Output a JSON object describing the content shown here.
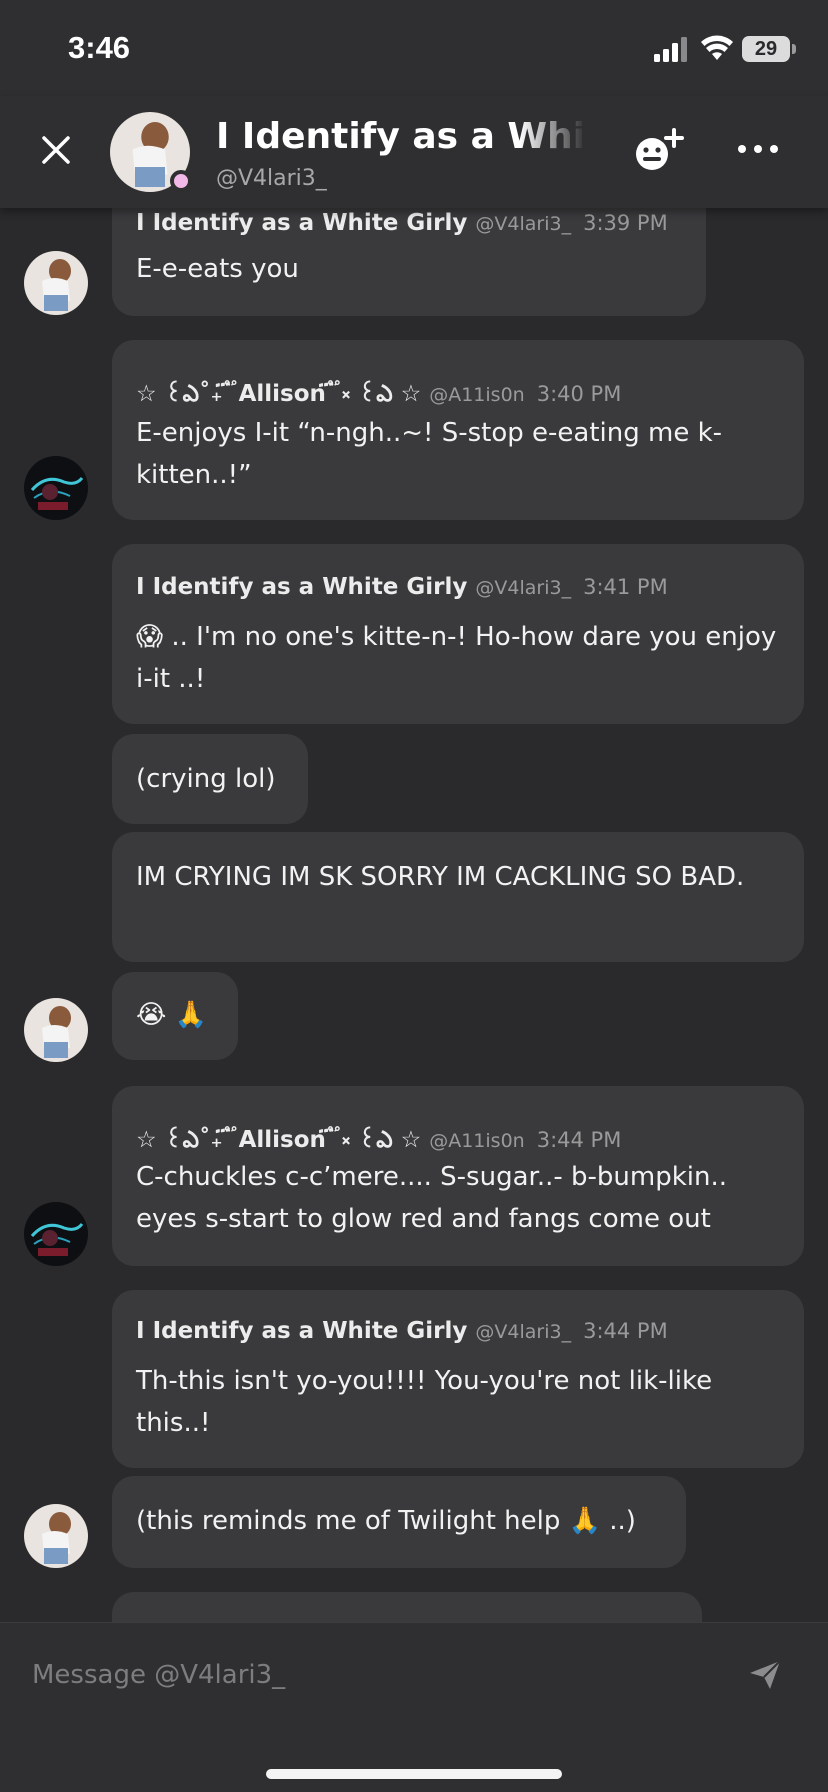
{
  "status_bar": {
    "time": "3:46",
    "battery": "29"
  },
  "header": {
    "title": "I Identify as a White Girly",
    "handle": "@V4lari3_",
    "presence_color": "#f2b8e8"
  },
  "icons": {
    "close": "close-icon",
    "add_emoji": "add-emoji-icon",
    "more": "more-icon",
    "send": "send-icon"
  },
  "messages": [
    {
      "name": "I Identify as a White Girly",
      "handle": "@V4lari3_",
      "time": "3:39 PM",
      "text": "E-e-eats you"
    },
    {
      "name": "☆ ꒰ఎ˚₊ ፝֟ Allison ፝֟ ༝ ꒰ఎ ☆",
      "handle": "@A11is0n",
      "time": "3:40 PM",
      "text": "E-enjoys I-it “n-ngh..~! S-stop e-eating me k-kitten..!”"
    },
    {
      "name": "I Identify as a White Girly",
      "handle": "@V4lari3_",
      "time": "3:41 PM",
      "text": "😱 .. I'm no one's kitte-n-! Ho-how dare you enjoy i-it ..!"
    },
    {
      "text": "(crying lol)"
    },
    {
      "text": "IM CRYING IM SK SORRY IM CACKLING SO BAD."
    },
    {
      "text": "😭 🙏"
    },
    {
      "name": "☆ ꒰ఎ˚₊ ፝֟ Allison ፝֟ ༝ ꒰ఎ ☆",
      "handle": "@A11is0n",
      "time": "3:44 PM",
      "text": "C-chuckles c-c’mere.... S-sugar..- b-bumpkin.. eyes s-start to glow red and fangs come out"
    },
    {
      "name": "I Identify as a White Girly",
      "handle": "@V4lari3_",
      "time": "3:44 PM",
      "text": "Th-this isn't yo-you!!!! You-you're not lik-like this..!"
    },
    {
      "text": "(this reminds me of Twilight help 🙏 ..)"
    }
  ],
  "composer": {
    "placeholder": "Message @V4lari3_"
  }
}
